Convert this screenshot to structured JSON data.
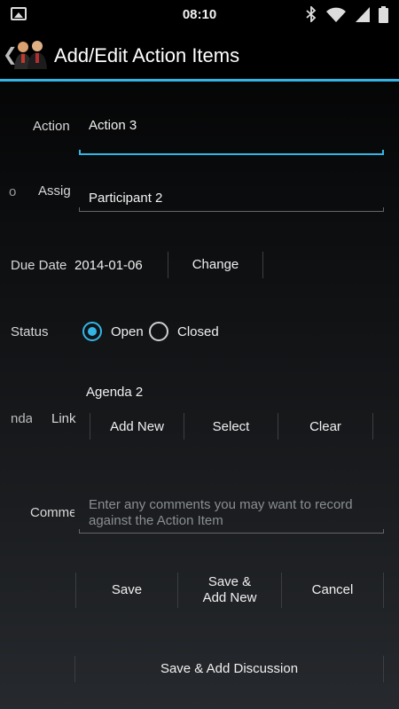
{
  "status_bar": {
    "time": "08:10",
    "icons": [
      "image-icon",
      "bluetooth-icon",
      "wifi-icon",
      "signal-icon",
      "battery-icon"
    ]
  },
  "action_bar": {
    "title": "Add/Edit Action Items",
    "accent_color": "#33b5e5"
  },
  "form": {
    "action": {
      "label": "Action",
      "value": "Action 3"
    },
    "assigned_to": {
      "label_prefix": "o",
      "label": "Assig",
      "value": "Participant 2"
    },
    "due_date": {
      "label": "Due Date",
      "value": "2014-01-06",
      "change_label": "Change"
    },
    "status": {
      "label": "Status",
      "options": [
        "Open",
        "Closed"
      ],
      "selected": "Open"
    },
    "agenda_link": {
      "label_prefix": "nda",
      "label": "Link",
      "value": "Agenda 2",
      "buttons": [
        "Add New",
        "Select",
        "Clear"
      ]
    },
    "comments": {
      "label": "Comme",
      "placeholder": "Enter any comments you may want to record against the Action Item"
    }
  },
  "footer_buttons": {
    "save": "Save",
    "save_add_new": "Save & Add New",
    "cancel": "Cancel",
    "save_add_discussion": "Save & Add Discussion"
  }
}
